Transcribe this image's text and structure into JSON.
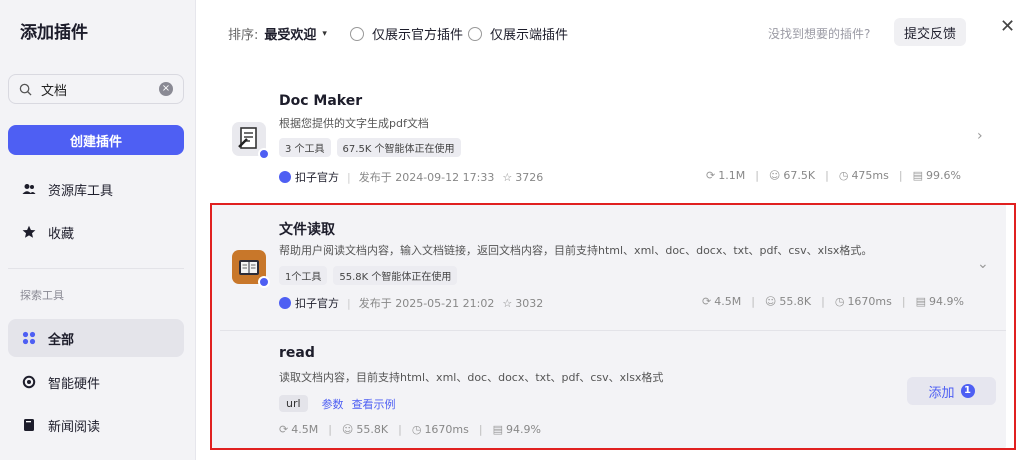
{
  "sidebar": {
    "title": "添加插件",
    "search": {
      "value": "文档",
      "clear_icon": "×"
    },
    "create_button": "创建插件",
    "items": [
      {
        "label": "资源库工具"
      },
      {
        "label": "收藏"
      }
    ],
    "section_title": "探索工具",
    "explore_items": [
      {
        "label": "全部"
      },
      {
        "label": "智能硬件"
      },
      {
        "label": "新闻阅读"
      }
    ]
  },
  "topbar": {
    "sort_label": "排序:",
    "sort_value": "最受欢迎",
    "sort_caret": "▾",
    "radio_official": "仅展示官方插件",
    "radio_client": "仅展示端插件",
    "hint": "没找到想要的插件?",
    "feedback_button": "提交反馈",
    "close_icon": "✕"
  },
  "plugins": [
    {
      "name": "Doc Maker",
      "description": "根据您提供的文字生成pdf文档",
      "tags": [
        "3 个工具",
        "67.5K 个智能体正在使用"
      ],
      "publisher": "扣子官方",
      "published": "发布于 2024-09-12 17:33",
      "stars": "3726",
      "stats": [
        "1.1M",
        "67.5K",
        "475ms",
        "99.6%"
      ],
      "chevron": "›"
    },
    {
      "name": "文件读取",
      "description": "帮助用户阅读文档内容，输入文档链接，返回文档内容，目前支持html、xml、doc、docx、txt、pdf、csv、xlsx格式。",
      "tags": [
        "1个工具",
        "55.8K 个智能体正在使用"
      ],
      "publisher": "扣子官方",
      "published": "发布于 2025-05-21 21:02",
      "stars": "3032",
      "stats": [
        "4.5M",
        "55.8K",
        "1670ms",
        "94.9%"
      ],
      "chevron": "⌄"
    }
  ],
  "tool": {
    "name": "read",
    "description": "读取文档内容，目前支持html、xml、doc、docx、txt、pdf、csv、xlsx格式",
    "param_tag": "url",
    "link_params": "参数",
    "link_example": "查看示例",
    "stats": [
      "4.5M",
      "55.8K",
      "1670ms",
      "94.9%"
    ],
    "add_button": "添加",
    "add_count": "1"
  },
  "colors": {
    "accent": "#4e5ff3",
    "highlight_border": "#e02020"
  }
}
